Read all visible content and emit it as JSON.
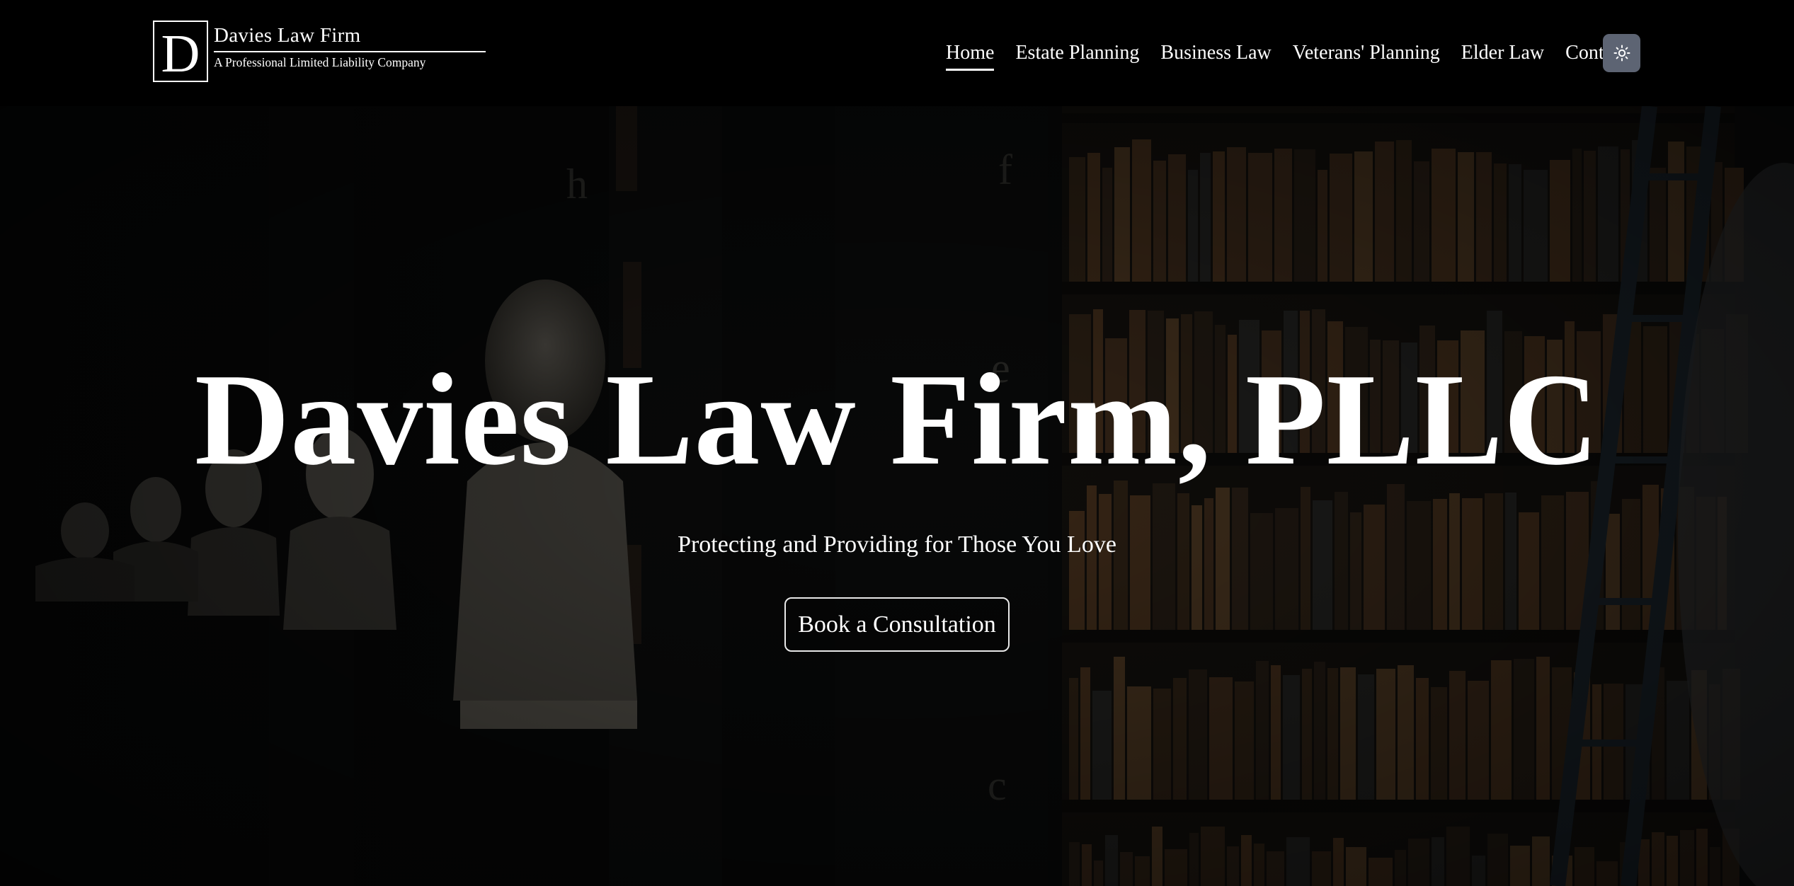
{
  "header": {
    "logo": {
      "letter": "D",
      "name": "Davies Law Firm",
      "tagline": "A Professional Limited Liability Company"
    },
    "nav": [
      {
        "label": "Home",
        "active": true
      },
      {
        "label": "Estate Planning"
      },
      {
        "label": "Business Law"
      },
      {
        "label": "Veterans' Planning"
      },
      {
        "label": "Elder Law"
      },
      {
        "label": "Contact"
      }
    ],
    "theme_toggle_icon": "sun-icon"
  },
  "hero": {
    "title": "Davies Law Firm, PLLC",
    "subtitle": "Protecting and Providing for Those You Love",
    "cta_label": "Book a Consultation",
    "background": "library-with-busts-and-bookshelves"
  },
  "colors": {
    "header_bg": "#000000",
    "toggle_bg": "#5d6473",
    "text": "#ffffff"
  }
}
